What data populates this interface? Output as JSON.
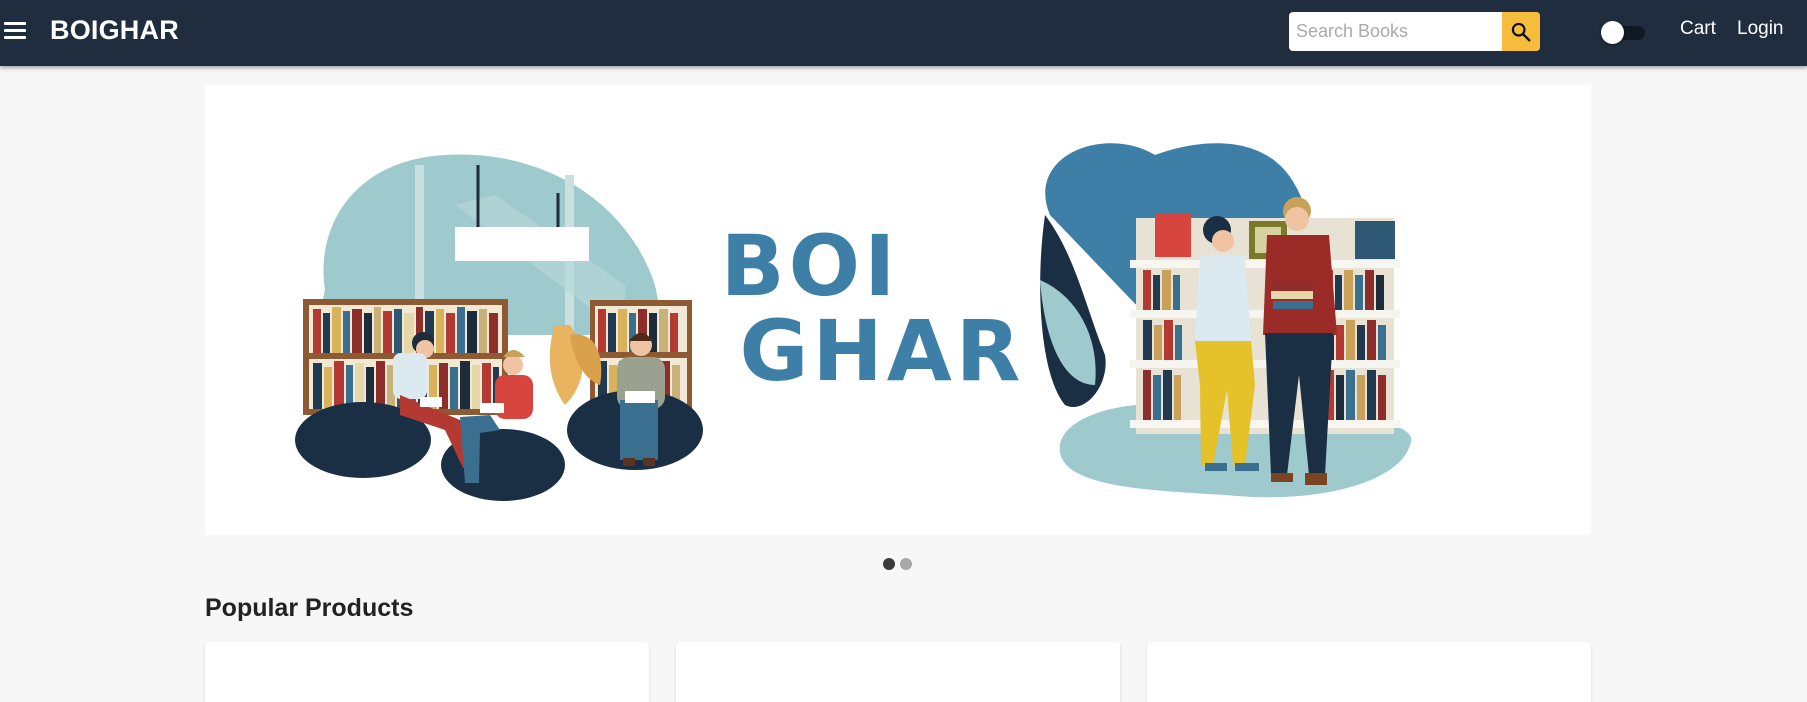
{
  "header": {
    "menu_icon": "hamburger-menu-icon",
    "brand": "BOIGHAR",
    "search": {
      "placeholder": "Search Books",
      "value": "",
      "button_icon": "search-icon"
    },
    "theme_toggle": {
      "checked": false
    },
    "links": {
      "cart": "Cart",
      "login": "Login"
    }
  },
  "banner": {
    "slide_title_line1": "BOI",
    "slide_title_line2": "GHAR",
    "slide_count": 2,
    "active_slide": 1
  },
  "popular_products": {
    "title": "Popular Products",
    "cards_visible": 3
  },
  "colors": {
    "appbar_bg": "#202d3e",
    "accent_yellow": "#f6bd3c",
    "banner_blue": "#3d7fa6",
    "page_bg": "#f7f7f7"
  }
}
